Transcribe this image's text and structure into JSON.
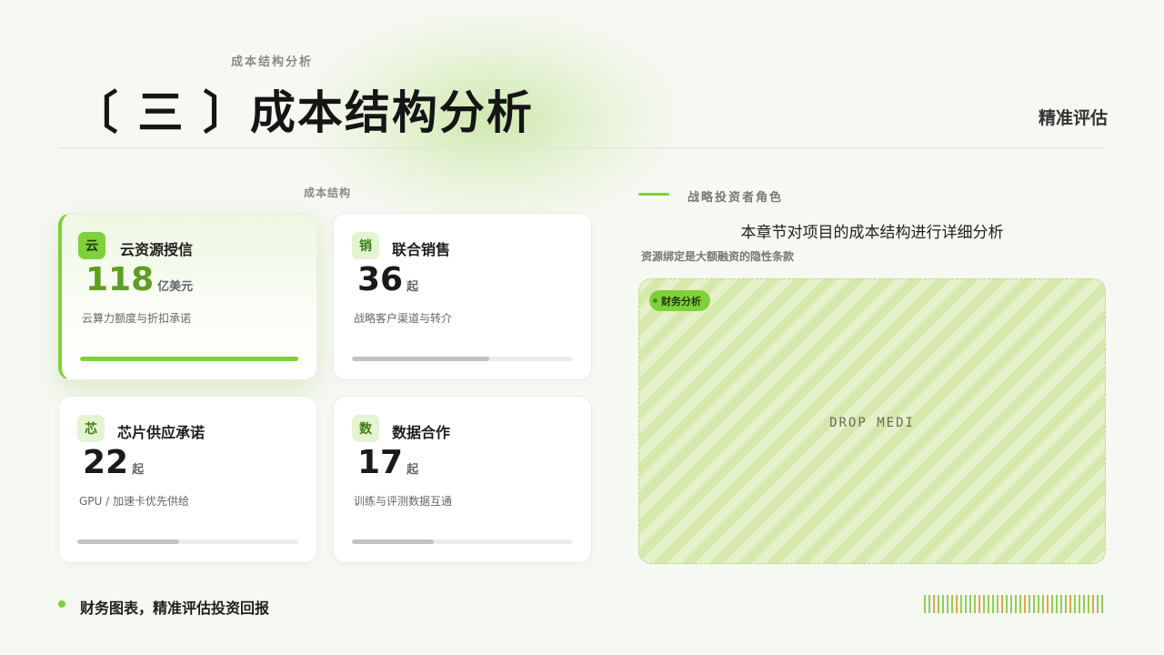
{
  "header": {
    "kicker": "成本结构分析",
    "title": "〔 三 〕成本结构分析",
    "corner_label": "精准评估"
  },
  "section": {
    "label": "成本结构"
  },
  "cards": [
    {
      "badge": "云",
      "name": "云资源授信",
      "value": "118",
      "unit": "亿美元",
      "desc": "云算力额度与折扣承诺",
      "progress": 1.0,
      "active": true
    },
    {
      "badge": "销",
      "name": "联合销售",
      "value": "36",
      "unit": "起",
      "desc": "战略客户渠道与转介",
      "progress": 0.62,
      "active": false
    },
    {
      "badge": "芯",
      "name": "芯片供应承诺",
      "value": "22",
      "unit": "起",
      "desc": "GPU /  加速卡优先供给",
      "progress": 0.46,
      "active": false
    },
    {
      "badge": "数",
      "name": "数据合作",
      "value": "17",
      "unit": "起",
      "desc": "训练与评测数据互通",
      "progress": 0.37,
      "active": false
    }
  ],
  "right": {
    "role_label": "战略投资者角色",
    "desc_title": "本章节对项目的成本结构进行详细分析",
    "desc_sub": "资源绑定是大额融资的隐性条款",
    "media_tag": "财务分析",
    "media_text": "DROP MEDI"
  },
  "footer": {
    "text": "财务图表，精准评估投资回报"
  },
  "colors": {
    "accent": "#7ed13a",
    "accent_dark": "#5e9f1f",
    "background": "#f6f8f2",
    "stripe_alt": "#f0a04b"
  }
}
